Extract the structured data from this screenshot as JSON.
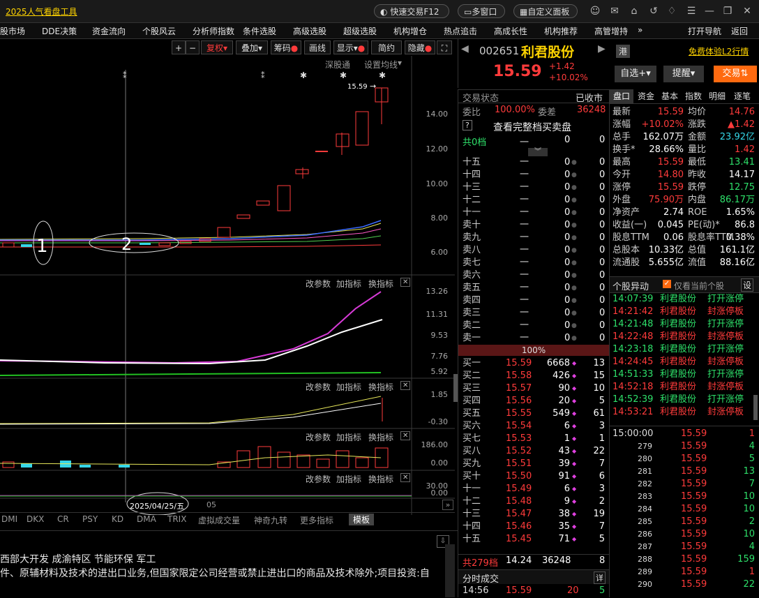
{
  "titlebar": {
    "app_title": "2025人气看盘工具",
    "quick_trade": "快速交易F12",
    "multi_window": "多窗口",
    "custom_panel": "自定义面板"
  },
  "menu": {
    "items": [
      "股市场",
      "DDE决策",
      "资金流向",
      "个股风云",
      "分析师指数",
      "条件选股",
      "高级选股",
      "超级选股",
      "机构增仓",
      "热点追击",
      "高成长性",
      "机构推荐",
      "高管增持"
    ],
    "more": "»",
    "open_nav": "打开导航",
    "back": "返回"
  },
  "chart_toolbar": {
    "plus": "+",
    "minus": "−",
    "fuquan": "复权",
    "diejia": "叠加",
    "chouma": "筹码",
    "huaxian": "画线",
    "xianshi": "显示",
    "jianyue": "简约",
    "yincang": "隐藏",
    "expand": "⛶"
  },
  "chart": {
    "shengutong": "深股通",
    "set_ma": "设置均线",
    "last_price_label": "15.59",
    "price_axis": [
      "14.00",
      "12.00",
      "10.00",
      "8.00",
      "6.00"
    ],
    "annot_1": "1",
    "annot_2": "2",
    "ind1_axis": [
      "13.26",
      "11.31",
      "9.53",
      "7.76",
      "5.92"
    ],
    "ind2_axis": [
      "1.85",
      "-0.30"
    ],
    "ind3_axis": [
      "186.00",
      "0.00"
    ],
    "ind4_axis": [
      "30.00",
      "0.00"
    ],
    "ind_ctrl": {
      "params": "改参数",
      "add": "加指标",
      "swap": "换指标",
      "close": "✕"
    },
    "date_label": "2025/04/25/五",
    "date_label2": "05"
  },
  "bottom_tabs": [
    "DMI",
    "DKX",
    "CR",
    "PSY",
    "KD",
    "DMA",
    "TRIX",
    "虚拟成交量",
    "神奇九转",
    "更多指标",
    "模板"
  ],
  "concept_line": "西部大开发  成渝特区  节能环保  军工",
  "business_line": "件、原辅材料及技术的进出口业务,但国家限定公司经营或禁止进出口的商品及技术除外;项目投资:自",
  "stock": {
    "code": "002651",
    "name": "利君股份",
    "badge": "港",
    "l2_link": "免费体验L2行情",
    "price": "15.59",
    "change": "+1.42",
    "change_pct": "+10.02%",
    "add_fav": "自选",
    "remind": "提醒",
    "trade": "交易"
  },
  "order_book": {
    "status_label": "交易状态",
    "status_value": "已收市",
    "weibi_label": "委比",
    "weibi_value": "100.00%",
    "weicha_label": "委差",
    "weicha_value": "36248",
    "full_book": "查看完整档买卖盘",
    "help": "?",
    "sell_total_label": "共0档",
    "sell_total_dash": "一",
    "sell_total_v1": "0",
    "sell_total_v2": "0",
    "sells": [
      {
        "label": "十五",
        "price": "一",
        "vol": "0",
        "cnt": "0"
      },
      {
        "label": "十四",
        "price": "一",
        "vol": "0",
        "cnt": "0"
      },
      {
        "label": "十三",
        "price": "一",
        "vol": "0",
        "cnt": "0"
      },
      {
        "label": "十二",
        "price": "一",
        "vol": "0",
        "cnt": "0"
      },
      {
        "label": "十一",
        "price": "一",
        "vol": "0",
        "cnt": "0"
      },
      {
        "label": "卖十",
        "price": "一",
        "vol": "0",
        "cnt": "0"
      },
      {
        "label": "卖九",
        "price": "一",
        "vol": "0",
        "cnt": "0"
      },
      {
        "label": "卖八",
        "price": "一",
        "vol": "0",
        "cnt": "0"
      },
      {
        "label": "卖七",
        "price": "一",
        "vol": "0",
        "cnt": "0"
      },
      {
        "label": "卖六",
        "price": "一",
        "vol": "0",
        "cnt": "0"
      },
      {
        "label": "卖五",
        "price": "一",
        "vol": "0",
        "cnt": "0"
      },
      {
        "label": "卖四",
        "price": "一",
        "vol": "0",
        "cnt": "0"
      },
      {
        "label": "卖三",
        "price": "一",
        "vol": "0",
        "cnt": "0"
      },
      {
        "label": "卖二",
        "price": "一",
        "vol": "0",
        "cnt": "0"
      },
      {
        "label": "卖一",
        "price": "一",
        "vol": "0",
        "cnt": "0"
      }
    ],
    "ratio": "100%",
    "buys": [
      {
        "label": "买一",
        "price": "15.59",
        "vol": "6668",
        "cnt": "13"
      },
      {
        "label": "买二",
        "price": "15.58",
        "vol": "426",
        "cnt": "15"
      },
      {
        "label": "买三",
        "price": "15.57",
        "vol": "90",
        "cnt": "10"
      },
      {
        "label": "买四",
        "price": "15.56",
        "vol": "20",
        "cnt": "5"
      },
      {
        "label": "买五",
        "price": "15.55",
        "vol": "549",
        "cnt": "61"
      },
      {
        "label": "买六",
        "price": "15.54",
        "vol": "6",
        "cnt": "3"
      },
      {
        "label": "买七",
        "price": "15.53",
        "vol": "1",
        "cnt": "1"
      },
      {
        "label": "买八",
        "price": "15.52",
        "vol": "43",
        "cnt": "22"
      },
      {
        "label": "买九",
        "price": "15.51",
        "vol": "39",
        "cnt": "7"
      },
      {
        "label": "买十",
        "price": "15.50",
        "vol": "91",
        "cnt": "6"
      },
      {
        "label": "十一",
        "price": "15.49",
        "vol": "6",
        "cnt": "3"
      },
      {
        "label": "十二",
        "price": "15.48",
        "vol": "9",
        "cnt": "2"
      },
      {
        "label": "十三",
        "price": "15.47",
        "vol": "38",
        "cnt": "19"
      },
      {
        "label": "十四",
        "price": "15.46",
        "vol": "35",
        "cnt": "7"
      },
      {
        "label": "十五",
        "price": "15.45",
        "vol": "71",
        "cnt": "5"
      }
    ],
    "buy_total_label": "共279档",
    "buy_total_price": "14.24",
    "buy_total_vol": "36248",
    "buy_total_cnt": "8",
    "time_trade_label": "分时成交",
    "detail": "详",
    "last_trade": {
      "time": "14:56",
      "price": "15.59",
      "vol": "20",
      "cnt": "5"
    }
  },
  "tabs_right": [
    "盘口",
    "资金",
    "基本",
    "指数",
    "明细",
    "逐笔"
  ],
  "quote": [
    {
      "l1": "最新",
      "v1": "15.59",
      "c1": "red",
      "l2": "均价",
      "v2": "14.76",
      "c2": "red"
    },
    {
      "l1": "涨幅",
      "v1": "+10.02%",
      "c1": "red",
      "l2": "涨跌",
      "v2": "▲1.42",
      "c2": "red"
    },
    {
      "l1": "总手",
      "v1": "162.07万",
      "c1": "white",
      "l2": "金额",
      "v2": "23.92亿",
      "c2": "cyan"
    },
    {
      "l1": "换手*",
      "v1": "28.66%",
      "c1": "white",
      "l2": "量比",
      "v2": "1.42",
      "c2": "red"
    },
    {
      "l1": "最高",
      "v1": "15.59",
      "c1": "red",
      "l2": "最低",
      "v2": "13.41",
      "c2": "green"
    },
    {
      "l1": "今开",
      "v1": "14.80",
      "c1": "red",
      "l2": "昨收",
      "v2": "14.17",
      "c2": "white"
    },
    {
      "l1": "涨停",
      "v1": "15.59",
      "c1": "red",
      "l2": "跌停",
      "v2": "12.75",
      "c2": "green"
    },
    {
      "l1": "外盘",
      "v1": "75.90万",
      "c1": "red",
      "l2": "内盘",
      "v2": "86.17万",
      "c2": "green"
    },
    {
      "l1": "净资产",
      "v1": "2.74",
      "c1": "white",
      "l2": "ROE",
      "v2": "1.65%",
      "c2": "white"
    },
    {
      "l1": "收益(一)",
      "v1": "0.045",
      "c1": "white",
      "l2": "PE(动)*",
      "v2": "86.8",
      "c2": "white"
    },
    {
      "l1": "股息TTM",
      "v1": "0.06",
      "c1": "white",
      "l2": "股息率TTM",
      "v2": "0.38%",
      "c2": "white"
    },
    {
      "l1": "总股本",
      "v1": "10.33亿",
      "c1": "white",
      "l2": "总值",
      "v2": "161.1亿",
      "c2": "white"
    },
    {
      "l1": "流通股",
      "v1": "5.655亿",
      "c1": "white",
      "l2": "流值",
      "v2": "88.16亿",
      "c2": "white"
    }
  ],
  "movers": {
    "title": "个股异动",
    "only_current": "仅看当前个股",
    "settings": "设",
    "rows": [
      {
        "time": "14:07:39",
        "name": "利君股份",
        "event": "打开涨停",
        "color": "green"
      },
      {
        "time": "14:21:42",
        "name": "利君股份",
        "event": "封涨停板",
        "color": "red"
      },
      {
        "time": "14:21:48",
        "name": "利君股份",
        "event": "打开涨停",
        "color": "green"
      },
      {
        "time": "14:22:48",
        "name": "利君股份",
        "event": "封涨停板",
        "color": "red"
      },
      {
        "time": "14:23:18",
        "name": "利君股份",
        "event": "打开涨停",
        "color": "green"
      },
      {
        "time": "14:24:45",
        "name": "利君股份",
        "event": "封涨停板",
        "color": "red"
      },
      {
        "time": "14:51:33",
        "name": "利君股份",
        "event": "打开涨停",
        "color": "green"
      },
      {
        "time": "14:52:18",
        "name": "利君股份",
        "event": "封涨停板",
        "color": "red"
      },
      {
        "time": "14:52:39",
        "name": "利君股份",
        "event": "打开涨停",
        "color": "green"
      },
      {
        "time": "14:53:21",
        "name": "利君股份",
        "event": "封涨停板",
        "color": "red"
      }
    ]
  },
  "ticks": {
    "header": {
      "time": "15:00:00",
      "price": "15.59",
      "vol": "1"
    },
    "rows": [
      {
        "n": "279",
        "price": "15.59",
        "vol": "4"
      },
      {
        "n": "280",
        "price": "15.59",
        "vol": "5"
      },
      {
        "n": "281",
        "price": "15.59",
        "vol": "13"
      },
      {
        "n": "282",
        "price": "15.59",
        "vol": "7"
      },
      {
        "n": "283",
        "price": "15.59",
        "vol": "10"
      },
      {
        "n": "284",
        "price": "15.59",
        "vol": "10"
      },
      {
        "n": "285",
        "price": "15.59",
        "vol": "2"
      },
      {
        "n": "286",
        "price": "15.59",
        "vol": "10"
      },
      {
        "n": "287",
        "price": "15.59",
        "vol": "4"
      },
      {
        "n": "288",
        "price": "15.59",
        "vol": "159"
      },
      {
        "n": "289",
        "price": "15.59",
        "vol": "1"
      },
      {
        "n": "290",
        "price": "15.59",
        "vol": "22"
      }
    ]
  },
  "colors": {
    "up": "#ff3b3b",
    "down": "#2ee06a",
    "accent": "#ffd400",
    "bg": "#000000"
  }
}
